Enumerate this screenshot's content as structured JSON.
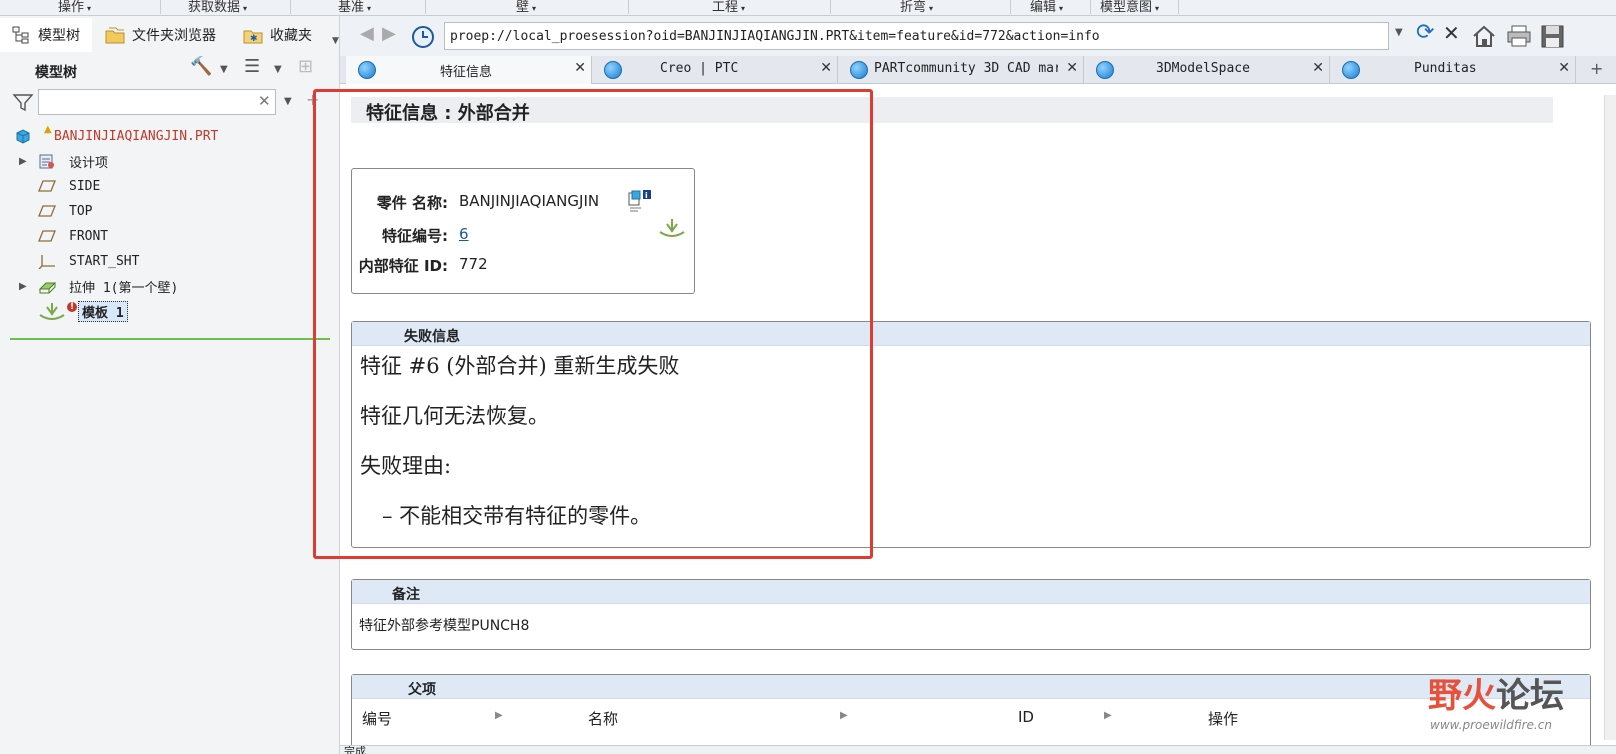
{
  "ribbon": {
    "items": [
      "操作",
      "获取数据",
      "基准",
      "壁",
      "工程",
      "折弯",
      "编辑",
      "模型意图"
    ]
  },
  "left_panel": {
    "tabs": [
      {
        "label": "模型树",
        "icon": "tree-icon"
      },
      {
        "label": "文件夹浏览器",
        "icon": "folder-icon"
      },
      {
        "label": "收藏夹",
        "icon": "favorites-icon"
      }
    ],
    "title": "模型树",
    "filter_placeholder": "",
    "tree": [
      {
        "label": "BANJINJIAQIANGJIN.PRT",
        "icon": "part-icon",
        "expand": "",
        "color": "#c0392b"
      },
      {
        "label": "设计项",
        "icon": "design-items-icon",
        "expand": "▶"
      },
      {
        "label": "SIDE",
        "icon": "datum-plane-icon",
        "expand": ""
      },
      {
        "label": "TOP",
        "icon": "datum-plane-icon",
        "expand": ""
      },
      {
        "label": "FRONT",
        "icon": "datum-plane-icon",
        "expand": ""
      },
      {
        "label": "START_SHT",
        "icon": "coordinate-system-icon",
        "expand": ""
      },
      {
        "label": "拉伸 1(第一个壁)",
        "icon": "extrude-icon",
        "expand": "▶"
      },
      {
        "label": "模板 1",
        "icon": "form-feature-icon",
        "expand": ""
      }
    ]
  },
  "browser": {
    "url": "proep://local_proesession?oid=BANJINJIAQIANGJIN.PRT&item=feature&id=772&action=info",
    "tabs": [
      {
        "label": "特征信息"
      },
      {
        "label": "Creo | PTC"
      },
      {
        "label": "PARTcommunity 3D CAD mar"
      },
      {
        "label": "3DModelSpace"
      },
      {
        "label": "Punditas"
      }
    ],
    "close_glyph": "✕"
  },
  "feature_info": {
    "title": "特征信息 : 外部合并",
    "part_name_label": "零件 名称:",
    "part_name_value": "BANJINJIAQIANGJIN",
    "feature_no_label": "特征编号:",
    "feature_no_value": "6",
    "internal_id_label": "内部特征 ID:",
    "internal_id_value": "772"
  },
  "failure": {
    "heading": "失败信息",
    "lines": [
      "特征 #6 (外部合并) 重新生成失败",
      "特征几何无法恢复。",
      "失败理由:",
      "  – 不能相交带有特征的零件。"
    ]
  },
  "notes": {
    "heading": "备注",
    "text": "特征外部参考模型PUNCH8"
  },
  "parents": {
    "heading": "父项",
    "columns": [
      "编号",
      "名称",
      "ID",
      "操作"
    ]
  },
  "watermark": {
    "text_red": "野火",
    "text_grey": "论坛",
    "url": "www.proewildfire.cn"
  },
  "status_text": "完成"
}
